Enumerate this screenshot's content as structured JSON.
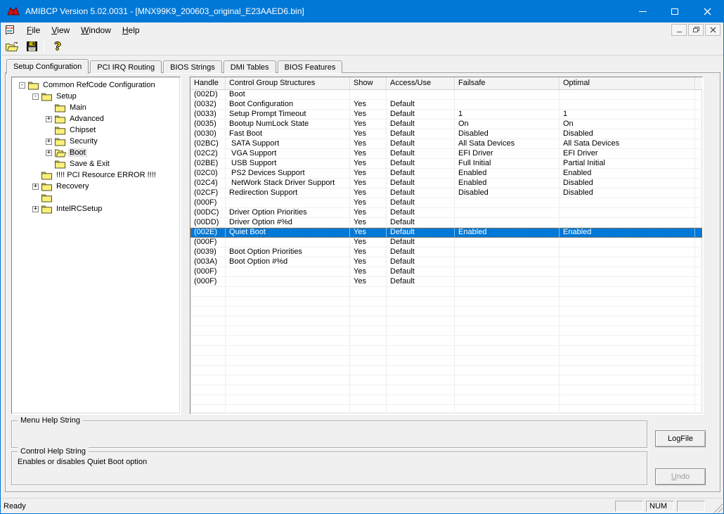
{
  "window": {
    "title": "AMIBCP Version 5.02.0031 - [MNX99K9_200603_original_E23AAED6.bin]"
  },
  "menu_bar": {
    "items": [
      "File",
      "View",
      "Window",
      "Help"
    ]
  },
  "toolbar": {
    "icons": [
      "open-file-icon",
      "save-file-icon",
      "help-icon"
    ]
  },
  "tabs": {
    "active": "Setup Configuration",
    "items": [
      "Setup Configuration",
      "PCI IRQ Routing",
      "BIOS Strings",
      "DMI Tables",
      "BIOS Features"
    ]
  },
  "tree": {
    "items": [
      {
        "label": "Common RefCode Configuration",
        "level": 0,
        "expander": "-",
        "icon": "folder-closed",
        "selected": false
      },
      {
        "label": "Setup",
        "level": 1,
        "expander": "-",
        "icon": "folder-closed",
        "selected": false
      },
      {
        "label": "Main",
        "level": 2,
        "expander": "",
        "icon": "folder-closed",
        "selected": false
      },
      {
        "label": "Advanced",
        "level": 2,
        "expander": "+",
        "icon": "folder-closed",
        "selected": false
      },
      {
        "label": "Chipset",
        "level": 2,
        "expander": "",
        "icon": "folder-closed",
        "selected": false
      },
      {
        "label": "Security",
        "level": 2,
        "expander": "+",
        "icon": "folder-closed",
        "selected": false
      },
      {
        "label": "Boot",
        "level": 2,
        "expander": "+",
        "icon": "folder-open",
        "selected": true
      },
      {
        "label": "Save & Exit",
        "level": 2,
        "expander": "",
        "icon": "folder-closed",
        "selected": false
      },
      {
        "label": "!!!! PCI Resource ERROR !!!!",
        "level": 1,
        "expander": "",
        "icon": "folder-closed",
        "selected": false
      },
      {
        "label": "Recovery",
        "level": 1,
        "expander": "+",
        "icon": "folder-closed",
        "selected": false
      },
      {
        "label": "",
        "level": 1,
        "expander": "",
        "icon": "folder-closed",
        "selected": false
      },
      {
        "label": "IntelRCSetup",
        "level": 1,
        "expander": "+",
        "icon": "folder-closed",
        "selected": false
      }
    ]
  },
  "table": {
    "columns": [
      "Handle",
      "Control Group Structures",
      "Show",
      "Access/Use",
      "Failsafe",
      "Optimal"
    ],
    "rows": [
      [
        "(002D)",
        "Boot",
        "",
        "",
        "",
        ""
      ],
      [
        "(0032)",
        "Boot Configuration",
        "Yes",
        "Default",
        "",
        ""
      ],
      [
        "(0033)",
        "Setup Prompt Timeout",
        "Yes",
        "Default",
        "1",
        "1"
      ],
      [
        "(0035)",
        "Bootup NumLock State",
        "Yes",
        "Default",
        "On",
        "On"
      ],
      [
        "(0030)",
        "Fast Boot",
        "Yes",
        "Default",
        "Disabled",
        "Disabled"
      ],
      [
        "(02BC)",
        " SATA Support",
        "Yes",
        "Default",
        "All Sata Devices",
        "All Sata Devices"
      ],
      [
        "(02C2)",
        " VGA Support",
        "Yes",
        "Default",
        "EFI Driver",
        "EFI Driver"
      ],
      [
        "(02BE)",
        " USB Support",
        "Yes",
        "Default",
        "Full Initial",
        "Partial Initial"
      ],
      [
        "(02C0)",
        " PS2 Devices Support",
        "Yes",
        "Default",
        "Enabled",
        "Enabled"
      ],
      [
        "(02C4)",
        " NetWork Stack Driver Support",
        "Yes",
        "Default",
        "Enabled",
        "Disabled"
      ],
      [
        "(02CF)",
        "Redirection Support",
        "Yes",
        "Default",
        "Disabled",
        "Disabled"
      ],
      [
        "(000F)",
        "",
        "Yes",
        "Default",
        "",
        ""
      ],
      [
        "(00DC)",
        "Driver Option Priorities",
        "Yes",
        "Default",
        "",
        ""
      ],
      [
        "(00DD)",
        "Driver Option #%d",
        "Yes",
        "Default",
        "",
        ""
      ],
      [
        "(002E)",
        "Quiet Boot",
        "Yes",
        "Default",
        "Enabled",
        "Enabled"
      ],
      [
        "(000F)",
        "",
        "Yes",
        "Default",
        "",
        ""
      ],
      [
        "(0039)",
        "Boot Option Priorities",
        "Yes",
        "Default",
        "",
        ""
      ],
      [
        "(003A)",
        "Boot Option #%d",
        "Yes",
        "Default",
        "",
        ""
      ],
      [
        "(000F)",
        "",
        "Yes",
        "Default",
        "",
        ""
      ],
      [
        "(000F)",
        "",
        "Yes",
        "Default",
        "",
        ""
      ]
    ],
    "selected_row_index": 14,
    "filler_row_count": 13
  },
  "help_panels": {
    "menu_help_label": "Menu Help String",
    "menu_help_text": "",
    "control_help_label": "Control Help String",
    "control_help_text": "Enables or disables Quiet Boot option"
  },
  "action_buttons": {
    "logfile": "LogFile",
    "undo": "Undo"
  },
  "status_bar": {
    "ready": "Ready",
    "panes": [
      "",
      "NUM",
      ""
    ]
  },
  "colors": {
    "titlebar": "#0078d7",
    "selection": "#0078d7",
    "selection_text": "#ffffff",
    "focus_dotted": "#cf6a0a",
    "folder_yellow": "#f9ef7a"
  }
}
